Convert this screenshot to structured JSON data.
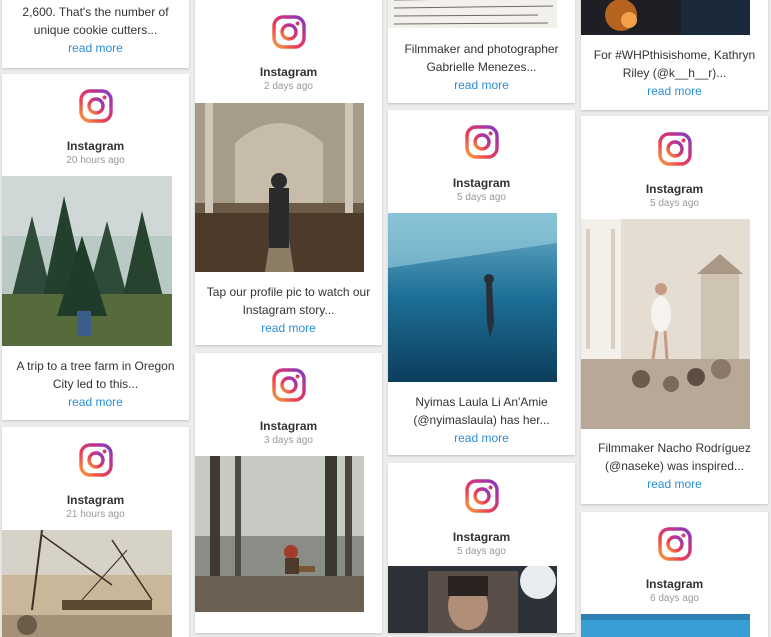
{
  "posts": {
    "p1": {
      "caption_l2": "unique cookie cutters...",
      "caption_l1": "2,600. That's the number of",
      "more": "read more"
    },
    "p2": {
      "source": "Instagram",
      "ago": "20 hours ago",
      "caption_l1": "A trip to a tree farm in Oregon",
      "caption_l2": "City led to this...",
      "more": "read more"
    },
    "p3": {
      "source": "Instagram",
      "ago": "21 hours ago"
    },
    "p4": {
      "source": "Instagram",
      "ago": "2 days ago",
      "caption_l1": "Tap our profile pic to watch our",
      "caption_l2": "Instagram story...",
      "more": "read more"
    },
    "p5": {
      "source": "Instagram",
      "ago": "3 days ago"
    },
    "p6": {
      "caption_l1": "Filmmaker and photographer",
      "caption_l2": "Gabrielle Menezes...",
      "more": "read more"
    },
    "p7": {
      "source": "Instagram",
      "ago": "5 days ago",
      "caption_l1": "Nyimas Laula Li An'Amie",
      "caption_l2": "(@nyimaslaula) has her...",
      "more": "read more"
    },
    "p8": {
      "source": "Instagram",
      "ago": "5 days ago"
    },
    "p9": {
      "caption_l1": "For #WHPthisishome, Kathryn",
      "caption_l2": "Riley (@k__h__r)...",
      "more": "read more"
    },
    "p10": {
      "source": "Instagram",
      "ago": "5 days ago",
      "caption_l1": "Filmmaker Nacho Rodríguez",
      "caption_l2": "(@naseke) was inspired...",
      "more": "read more"
    },
    "p11": {
      "source": "Instagram",
      "ago": "6 days ago"
    }
  },
  "icons": {
    "logo": "instagram-icon"
  },
  "colors": {
    "link": "#2b8ed6",
    "background": "#ececec"
  }
}
